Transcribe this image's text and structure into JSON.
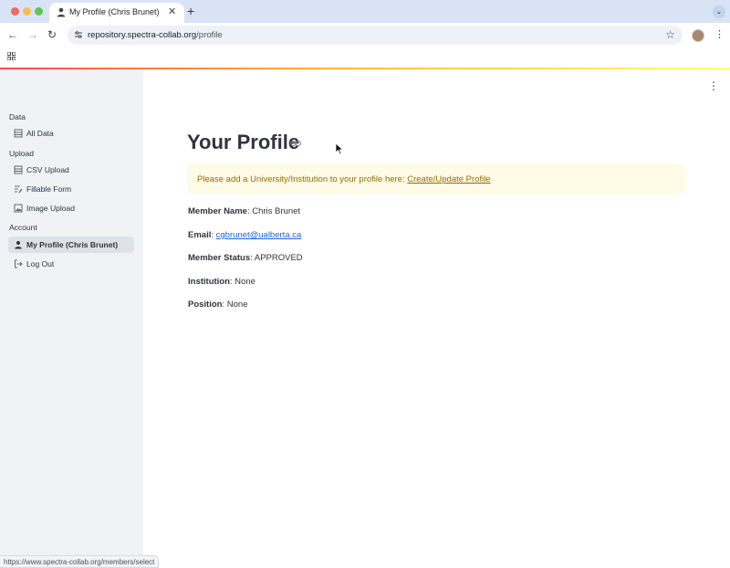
{
  "browser": {
    "tab_title": "My Profile (Chris Brunet)",
    "url_host": "repository.spectra-collab.org",
    "url_path": "/profile",
    "status_url": "https://www.spectra-collab.org/members/select"
  },
  "sidebar": {
    "sections": [
      {
        "label": "Data",
        "items": [
          {
            "label": "All Data",
            "icon": "table-icon"
          }
        ]
      },
      {
        "label": "Upload",
        "items": [
          {
            "label": "CSV Upload",
            "icon": "table-icon"
          },
          {
            "label": "Fillable Form",
            "icon": "form-icon"
          },
          {
            "label": "Image Upload",
            "icon": "image-icon"
          }
        ]
      },
      {
        "label": "Account",
        "items": [
          {
            "label": "My Profile (Chris Brunet)",
            "icon": "person-icon",
            "active": true
          },
          {
            "label": "Log Out",
            "icon": "logout-icon"
          }
        ]
      }
    ]
  },
  "main": {
    "title": "Your Profile",
    "alert": {
      "text": "Please add a University/Institution to your profile here: ",
      "link": "Create/Update Profile"
    },
    "fields": {
      "member_name": {
        "label": "Member Name",
        "value": ": Chris Brunet"
      },
      "email": {
        "label": "Email",
        "sep": ": ",
        "value": "cgbrunet@ualberta.ca"
      },
      "member_status": {
        "label": "Member Status",
        "value": ": APPROVED"
      },
      "institution": {
        "label": "Institution",
        "value": ": None"
      },
      "position": {
        "label": "Position",
        "value": ": None"
      }
    }
  },
  "colors": {
    "sidebar_bg": "#f0f2f6",
    "alert_bg": "#fffbe6",
    "alert_text": "#926c05",
    "link": "#1c64d8"
  }
}
